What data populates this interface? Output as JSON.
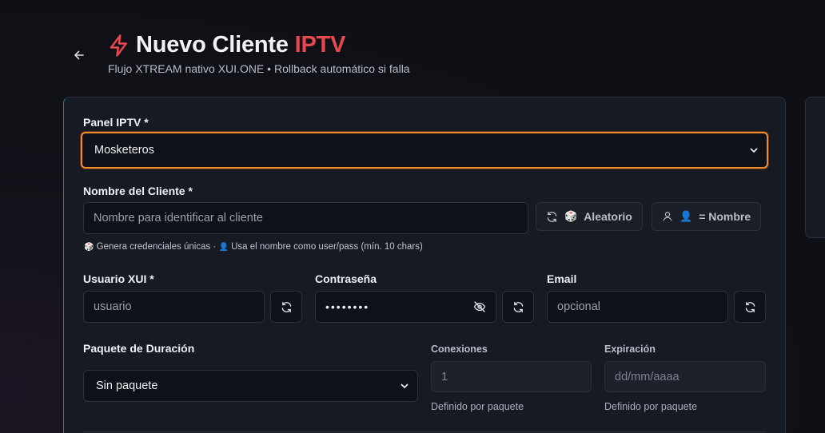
{
  "header": {
    "title_main": "Nuevo Cliente",
    "title_accent": "IPTV",
    "subtitle": "Flujo XTREAM nativo XUI.ONE • Rollback automático si falla",
    "back_icon": "arrow-left-icon",
    "title_icon": "lightning-bolt-icon"
  },
  "form": {
    "panel": {
      "label": "Panel IPTV *",
      "value": "Mosketeros"
    },
    "client_name": {
      "label": "Nombre del Cliente *",
      "placeholder": "Nombre para identificar al cliente",
      "random_button": "Aleatorio",
      "name_button": "= Nombre",
      "hint_random": "Genera credenciales únicas",
      "hint_sep": "·",
      "hint_name": "Usa el nombre como user/pass (mín. 10 chars)"
    },
    "user": {
      "label": "Usuario XUI *",
      "placeholder": "usuario"
    },
    "password": {
      "label": "Contraseña",
      "masked": "••••••••"
    },
    "email": {
      "label": "Email",
      "placeholder": "opcional"
    },
    "package": {
      "label": "Paquete de Duración",
      "value": "Sin paquete"
    },
    "connections": {
      "label": "Conexiones",
      "value": "1",
      "hint": "Definido por paquete"
    },
    "expiration": {
      "label": "Expiración",
      "placeholder": "dd/mm/aaaa",
      "hint": "Definido por paquete"
    }
  },
  "colors": {
    "accent": "#e5484d",
    "focus": "#f28a2e",
    "background": "#0f1117",
    "card": "#161a22"
  }
}
